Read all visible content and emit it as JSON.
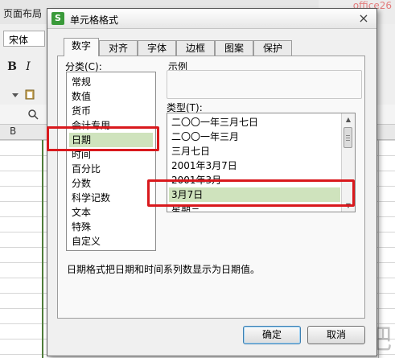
{
  "app": {
    "menu_tab": "页面布局",
    "font_name": "宋体",
    "bold_label": "B",
    "italic_label": "I",
    "column_header": "B"
  },
  "watermarks": {
    "top_right": "office26",
    "bottom_right": "下载吧"
  },
  "dialog": {
    "title": "单元格格式",
    "icon_letter": "S",
    "close_label": "×",
    "tabs": [
      {
        "label": "数字",
        "active": true
      },
      {
        "label": "对齐",
        "active": false
      },
      {
        "label": "字体",
        "active": false
      },
      {
        "label": "边框",
        "active": false
      },
      {
        "label": "图案",
        "active": false
      },
      {
        "label": "保护",
        "active": false
      }
    ],
    "category_label": "分类(C):",
    "categories": [
      {
        "label": "常规",
        "selected": false
      },
      {
        "label": "数值",
        "selected": false
      },
      {
        "label": "货币",
        "selected": false
      },
      {
        "label": "会计专用",
        "selected": false
      },
      {
        "label": "日期",
        "selected": true
      },
      {
        "label": "时间",
        "selected": false
      },
      {
        "label": "百分比",
        "selected": false
      },
      {
        "label": "分数",
        "selected": false
      },
      {
        "label": "科学记数",
        "selected": false
      },
      {
        "label": "文本",
        "selected": false
      },
      {
        "label": "特殊",
        "selected": false
      },
      {
        "label": "自定义",
        "selected": false
      }
    ],
    "sample_label": "示例",
    "sample_value": "",
    "type_label": "类型(T):",
    "types": [
      {
        "label": "二〇〇一年三月七日",
        "selected": false
      },
      {
        "label": "二〇〇一年三月",
        "selected": false
      },
      {
        "label": "三月七日",
        "selected": false
      },
      {
        "label": "2001年3月7日",
        "selected": false
      },
      {
        "label": "2001年3月",
        "selected": false
      },
      {
        "label": "3月7日",
        "selected": true
      },
      {
        "label": "星期三",
        "selected": false
      }
    ],
    "description": "日期格式把日期和时间系列数显示为日期值。",
    "ok_label": "确定",
    "cancel_label": "取消"
  },
  "colors": {
    "selection": "#cfe3bd",
    "highlight_red": "#d9191d",
    "app_icon_green": "#3a9a3a"
  }
}
